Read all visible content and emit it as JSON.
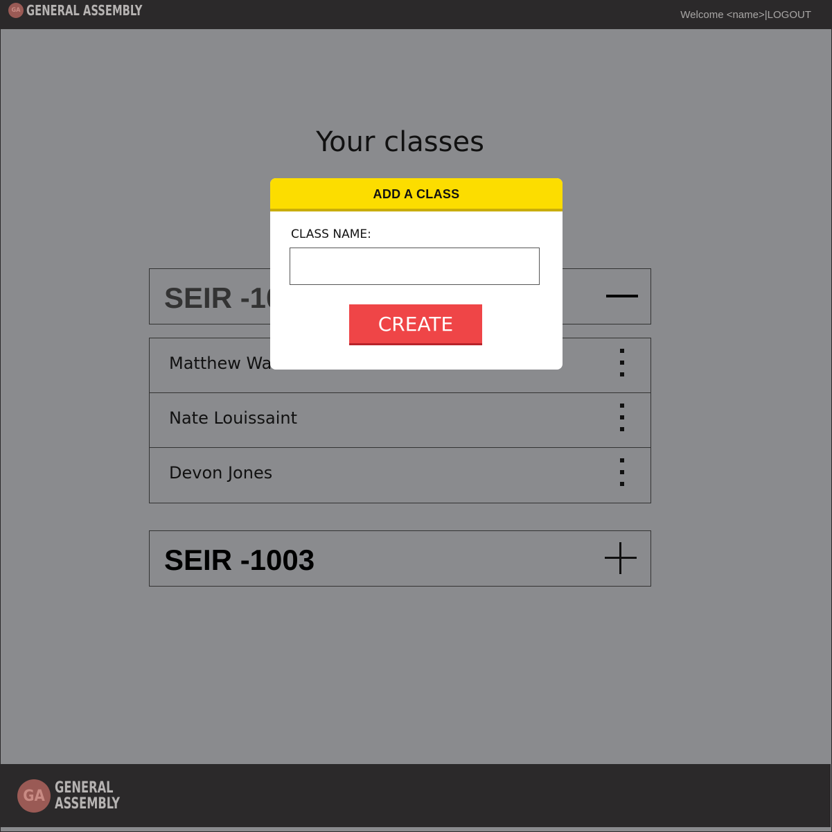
{
  "header": {
    "logo_badge": "GA",
    "logo_text": "GENERAL ASSEMBLY",
    "welcome_text": "Welcome <name>|",
    "logout_label": "LOGOUT"
  },
  "main": {
    "title": "Your classes",
    "classes": [
      {
        "name": "SEIR -1001",
        "expanded": true,
        "toggle_icon": "minus-icon",
        "students": [
          {
            "name": "Matthew Wade"
          },
          {
            "name": "Nate Louissaint"
          },
          {
            "name": "Devon Jones"
          }
        ]
      },
      {
        "name": "SEIR -1003",
        "expanded": false,
        "toggle_icon": "plus-icon"
      }
    ]
  },
  "modal": {
    "title": "ADD A CLASS",
    "field_label": "CLASS NAME:",
    "field_value": "",
    "field_placeholder": "",
    "create_label": "CREATE"
  },
  "footer": {
    "logo_badge": "GA",
    "logo_line1": "GENERAL",
    "logo_line2": "ASSEMBLY"
  },
  "colors": {
    "topbar": "#2b292a",
    "background": "#8a8b8e",
    "modal_header": "#fcdd00",
    "create_button": "#ef4547"
  }
}
